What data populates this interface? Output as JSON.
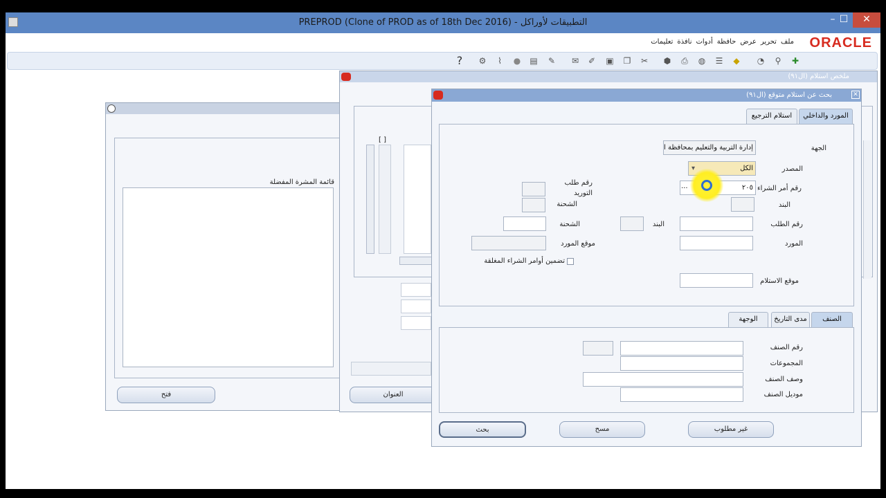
{
  "window": {
    "title": "PREPROD (Clone of PROD as of 18th Dec 2016) - التطبيقات لأوراكل",
    "min": "–",
    "max": "☐",
    "close": "✕"
  },
  "menubar": {
    "brand": "ORACLE",
    "items": [
      "ملف",
      "تحرير",
      "عرض",
      "حافظة",
      "أدوات",
      "نافذة",
      "تعليمات"
    ]
  },
  "toolbar": {
    "help": "?"
  },
  "left_window": {
    "list_label": "قائمة المشرة المفضلة",
    "open_button": "فتح"
  },
  "mid_window": {
    "title": "ملخص استلام (ال٩١)",
    "address_button": "العنوان",
    "col_brackets": "[ ]"
  },
  "find_dialog": {
    "title": "بحث عن استلام متوقع (ال٩١)",
    "tabs": {
      "supplier_internal": "المورد والداخلي",
      "rma": "استلام الترجيع"
    },
    "fields": {
      "org_label": "الجهة",
      "org_value": "إدارة التربية والتعليم بمحافظة الم",
      "source_label": "المصدر",
      "source_value": "الكل",
      "po_label": "رقم أمر الشراء",
      "po_value": "٢٠٥",
      "po_lov": "...",
      "req_supply_label": "رقم طلب التوريد",
      "line_label": "البند",
      "shipment_label_1": "الشحنة",
      "req_label": "رقم الطلب",
      "line_label_2": "البند",
      "shipment_label_2": "الشحنة",
      "supplier_label": "المورد",
      "supplier_site_label": "موقع المورد",
      "include_closed_label": "تضمين أوامر الشراء المغلقة",
      "receipt_location_label": "موقع الاستلام"
    },
    "lower_tabs": {
      "item": "الصنف",
      "date_range": "مدى التاريخ",
      "destination": "الوجهة"
    },
    "item_fields": {
      "item_no": "رقم الصنف",
      "categories": "المجموعات",
      "item_desc": "وصف الصنف",
      "item_alt": "موديل الصنف"
    },
    "buttons": {
      "not_required": "غير مطلوب",
      "clear": "مسح",
      "find": "بحث"
    }
  },
  "colors": {
    "titlebar": "#5b86c4",
    "oracle_red": "#d72b1f",
    "dialog_header": "#8aa8d4"
  }
}
